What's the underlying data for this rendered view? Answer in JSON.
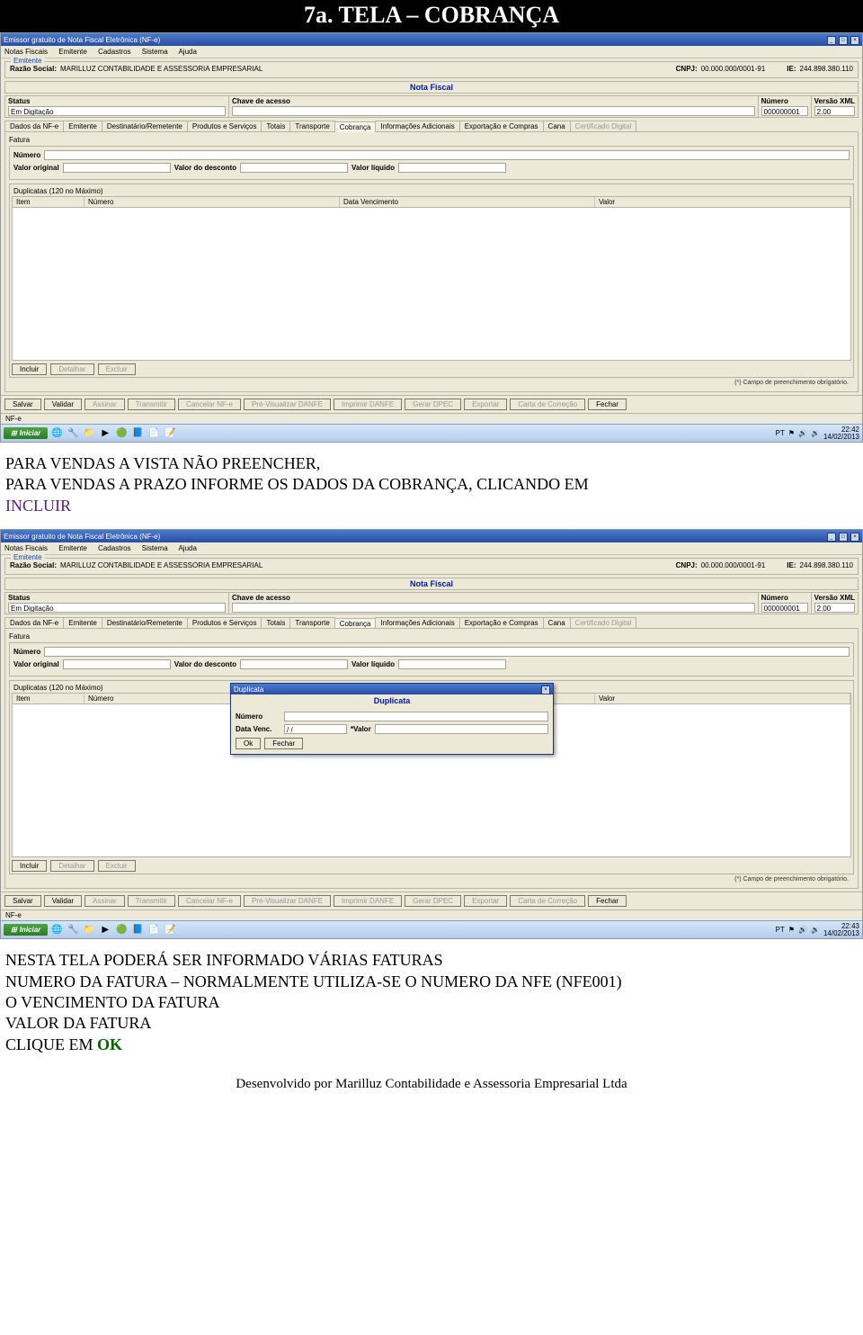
{
  "document": {
    "title": "7a. TELA – COBRANÇA",
    "instr1_l1": "PARA VENDAS A VISTA NÃO PREENCHER,",
    "instr1_l2": "PARA VENDAS A PRAZO INFORME OS DADOS DA COBRANÇA, CLICANDO EM",
    "instr1_kw": "INCLUIR",
    "instr2_l1": "NESTA TELA PODERÁ SER INFORMADO VÁRIAS FATURAS",
    "instr2_l2": "NUMERO DA FATURA – NORMALMENTE UTILIZA-SE O NUMERO DA NFE (NFE001)",
    "instr2_l3": "O VENCIMENTO DA FATURA",
    "instr2_l4": "VALOR DA FATURA",
    "instr2_l5": "CLIQUE EM ",
    "instr2_kw": "OK",
    "footer": "Desenvolvido por  Marilluz Contabilidade e Assessoria Empresarial Ltda"
  },
  "app": {
    "window_title": "Emissor gratuito de Nota Fiscal Eletrônica (NF-e)",
    "menus": [
      "Notas Fiscais",
      "Emitente",
      "Cadastros",
      "Sistema",
      "Ajuda"
    ],
    "emitente": {
      "legend": "Emitente",
      "razao_lbl": "Razão Social:",
      "razao_val": "MARILLUZ CONTABILIDADE E ASSESSORIA EMPRESARIAL",
      "cnpj_lbl": "CNPJ:",
      "cnpj_val": "00.000.000/0001-91",
      "ie_lbl": "IE:",
      "ie_val": "244.898.380.110"
    },
    "nota_fiscal_title": "Nota Fiscal",
    "status": {
      "status_lbl": "Status",
      "status_val": "Em Digitação",
      "chave_lbl": "Chave de acesso",
      "chave_val": "",
      "numero_lbl": "Número",
      "numero_val": "000000001",
      "versao_lbl": "Versão XML",
      "versao_val": "2.00"
    },
    "tabs": [
      "Dados da NF-e",
      "Emitente",
      "Destinatário/Remetente",
      "Produtos e Serviços",
      "Totais",
      "Transporte",
      "Cobrança",
      "Informações Adicionais",
      "Exportação e Compras",
      "Cana",
      "Certificado Digital"
    ],
    "fatura": {
      "group": "Fatura",
      "numero_lbl": "Número",
      "valor_original_lbl": "Valor original",
      "valor_desconto_lbl": "Valor do desconto",
      "valor_liquido_lbl": "Valor líquido"
    },
    "duplicatas": {
      "title": "Duplicatas (120 no Máximo)",
      "cols": [
        "Item",
        "Número",
        "Data Vencimento",
        "Valor"
      ]
    },
    "dup_buttons": {
      "incluir": "Incluir",
      "detalhar": "Detalhar",
      "excluir": "Excluir"
    },
    "footnote": "(*) Campo de preenchimento obrigatório.",
    "bottom_buttons": [
      "Salvar",
      "Validar",
      "Assinar",
      "Transmitir",
      "Cancelar NF-e",
      "Pré-Visualizar DANFE",
      "Imprimir DANFE",
      "Gerar DPEC",
      "Exportar",
      "Carta de Correção",
      "Fechar"
    ],
    "nfe_label": "NF-e",
    "dialog": {
      "win_title": "Duplicata",
      "title": "Duplicata",
      "numero_lbl": "Número",
      "data_lbl": "Data Venc.",
      "data_val": "  /  /    ",
      "valor_lbl": "*Valor",
      "ok": "Ok",
      "fechar": "Fechar"
    }
  },
  "taskbar": {
    "start": "Iniciar",
    "lang": "PT",
    "time1": "22:42",
    "date1": "14/02/2013",
    "time2": "22:43",
    "date2": "14/02/2013"
  },
  "icons": {
    "ie": "🌐",
    "app2": "🔧",
    "folder": "📁",
    "wmp": "▶",
    "chrome": "🟢",
    "office": "📘",
    "page": "📄",
    "doc": "📝",
    "flag": "⚑",
    "net": "🔊",
    "sound": "🔉"
  }
}
